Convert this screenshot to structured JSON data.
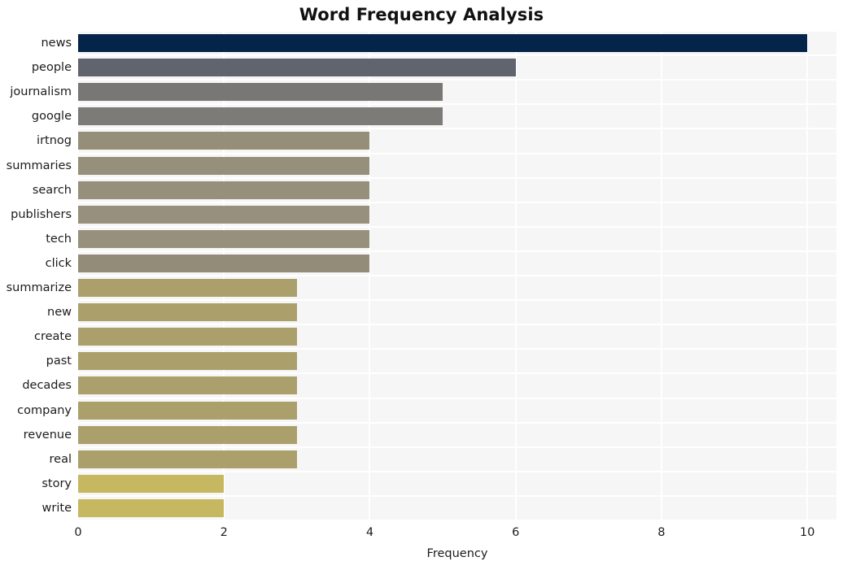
{
  "chart_data": {
    "type": "bar",
    "orientation": "horizontal",
    "title": "Word Frequency Analysis",
    "xlabel": "Frequency",
    "ylabel": "",
    "categories": [
      "news",
      "people",
      "journalism",
      "google",
      "irtnog",
      "summaries",
      "search",
      "publishers",
      "tech",
      "click",
      "summarize",
      "new",
      "create",
      "past",
      "decades",
      "company",
      "revenue",
      "real",
      "story",
      "write"
    ],
    "values": [
      10,
      6,
      5,
      5,
      4,
      4,
      4,
      4,
      4,
      4,
      3,
      3,
      3,
      3,
      3,
      3,
      3,
      3,
      2,
      2
    ],
    "bar_colors": [
      "#042449",
      "#60646f",
      "#787775",
      "#7d7b78",
      "#958f7a",
      "#968f7b",
      "#968f7b",
      "#96907c",
      "#96907c",
      "#928c79",
      "#ab9f6c",
      "#ab9f6c",
      "#ab9f6c",
      "#ab9f6c",
      "#ab9f6c",
      "#ab9f6c",
      "#ab9f6c",
      "#ab9f6c",
      "#c6b860",
      "#c6b860"
    ],
    "xlim": [
      0,
      10.4
    ],
    "xticks": [
      0,
      2,
      4,
      6,
      8,
      10
    ],
    "xtick_labels": [
      "0",
      "2",
      "4",
      "6",
      "8",
      "10"
    ],
    "grid": true,
    "legend": false,
    "plot_background": "#f6f6f6",
    "gridline_color": "#ffffff",
    "figure_background": "#ffffff",
    "title_color": "#111111"
  }
}
